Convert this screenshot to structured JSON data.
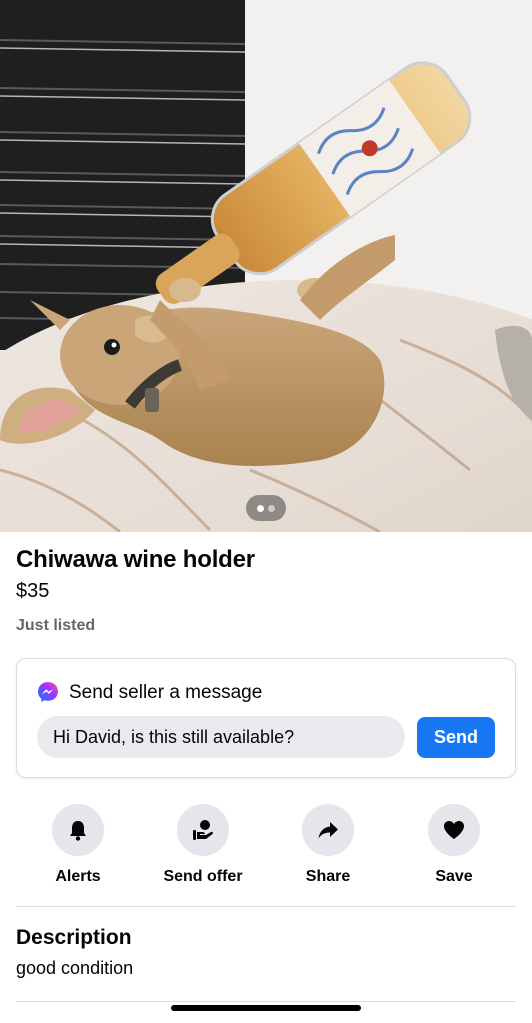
{
  "listing": {
    "title": "Chiwawa wine holder",
    "price": "$35",
    "status": "Just listed",
    "photo_count": 2,
    "active_photo": 1
  },
  "message_card": {
    "heading": "Send seller a message",
    "input_value": "Hi David, is this still available?",
    "send_label": "Send",
    "icon": "messenger-icon"
  },
  "actions": [
    {
      "label": "Alerts",
      "icon": "bell-icon"
    },
    {
      "label": "Send offer",
      "icon": "offer-icon"
    },
    {
      "label": "Share",
      "icon": "share-icon"
    },
    {
      "label": "Save",
      "icon": "heart-icon"
    }
  ],
  "description": {
    "heading": "Description",
    "text": "good condition"
  },
  "colors": {
    "accent": "#1877f2",
    "secondary_text": "#65676b",
    "chip_bg": "#e4e6eb"
  }
}
